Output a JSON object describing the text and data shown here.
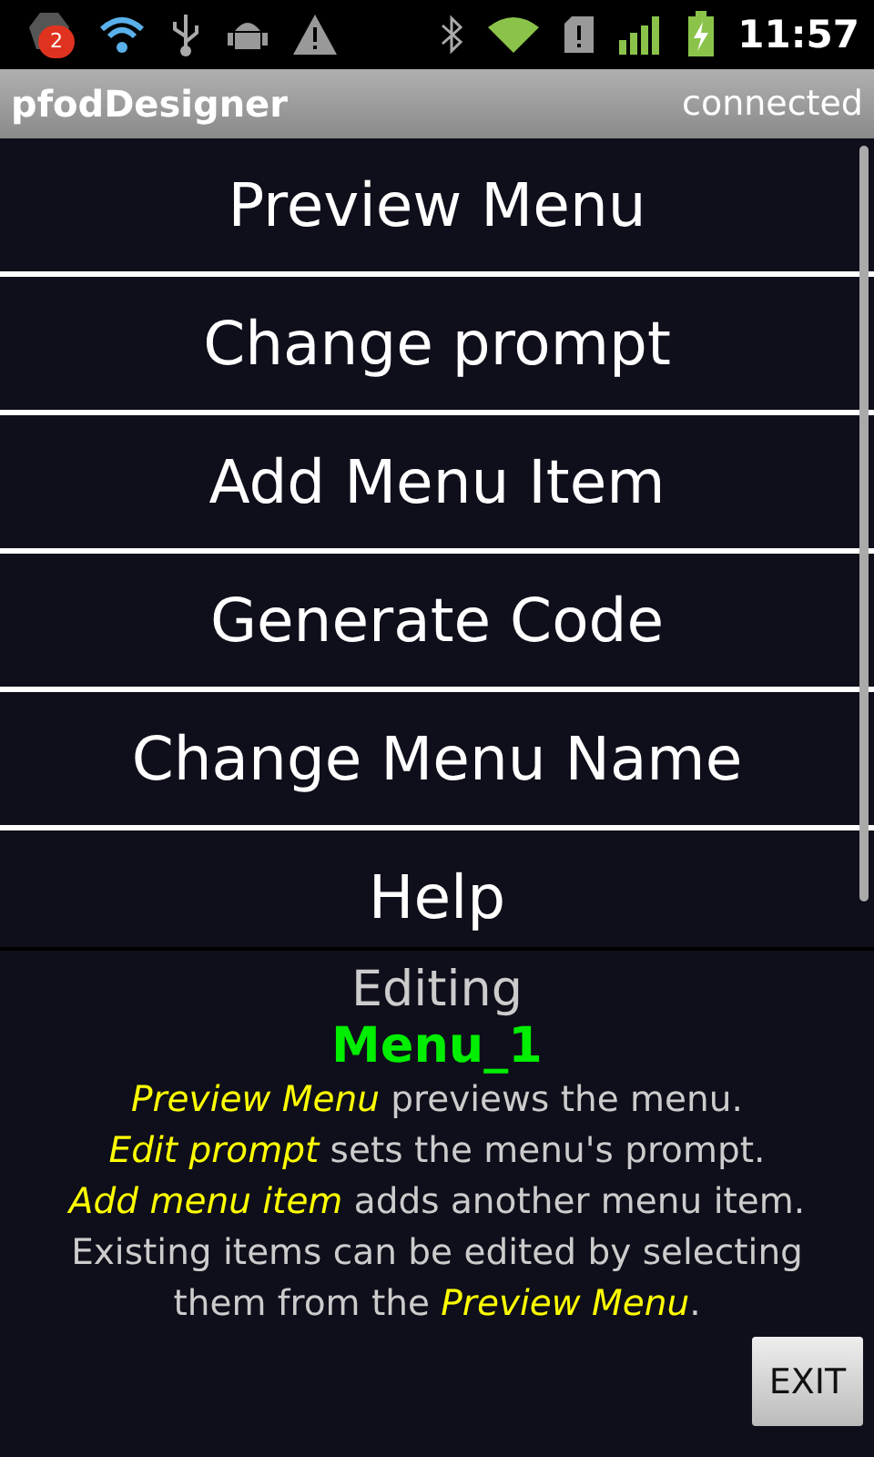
{
  "status_bar": {
    "badge": "2",
    "time": "11:57"
  },
  "title_bar": {
    "title": "pfodDesigner",
    "status": "connected"
  },
  "menu": [
    {
      "label": "Preview Menu"
    },
    {
      "label": "Change prompt"
    },
    {
      "label": "Add Menu Item"
    },
    {
      "label": "Generate Code"
    },
    {
      "label": "Change Menu Name"
    },
    {
      "label": "Help"
    }
  ],
  "panel": {
    "heading": "Editing",
    "name": "Menu_1",
    "help": [
      "*Preview Menu* previews the menu.",
      "*Edit prompt* sets the menu's prompt.",
      "*Add menu item* adds another menu item.",
      "Existing items can be edited by selecting them from the *Preview Menu*."
    ],
    "button": "EXIT"
  }
}
